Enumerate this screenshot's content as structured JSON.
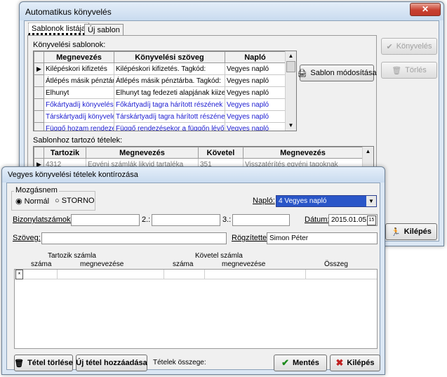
{
  "main_window": {
    "title": "Automatikus könyvelés",
    "close": "✕",
    "tabs": [
      "Sablonok listája",
      "Új sablon"
    ],
    "templates_label": "Könyvelési sablonok:",
    "templates_columns": [
      "Megnevezés",
      "Könyvelési szöveg",
      "Napló"
    ],
    "templates_rows": [
      {
        "name": "Kilépéskori kifizetés",
        "text": "Kilépéskori kifizetés. Tagkód:",
        "journal": "Vegyes napló",
        "color": "#000000"
      },
      {
        "name": "Átlépés másik pénztárba",
        "text": "Átlépés másik pénztárba. Tagkód:",
        "journal": "Vegyes napló",
        "color": "#000000"
      },
      {
        "name": "Elhunyt",
        "text": "Elhunyt tag fedezeti alapjának kiizetése",
        "journal": "Vegyes napló",
        "color": "#000000"
      },
      {
        "name": "Főkártyadíj könyvelése",
        "text": "Főkártyadíj tagra hárított részének könyvelése",
        "journal": "Vegyes napló",
        "color": "#1a1ad0"
      },
      {
        "name": "Társkártyadíj könyvelése",
        "text": "Társkártyadíj tagra hárított részének könyvelése",
        "journal": "Vegyes napló",
        "color": "#1a1ad0"
      },
      {
        "name": "Függő hozam rendezése",
        "text": "Függő rendezésekor a függőn lévő hozam",
        "journal": "Vegyes napló",
        "color": "#1a1ad0"
      }
    ],
    "sablon_modositasa": "Sablon módosítása",
    "konyveles": "Könyvelés",
    "torles": "Törlés",
    "items_label": "Sablonhoz tartozó tételek:",
    "items_columns": [
      "Tartozik",
      "Megnevezés",
      "Követel",
      "Megnevezés"
    ],
    "items_rows": [
      {
        "debit": "4312",
        "debit_name": "Egyéni számlák likvid tartaléka",
        "credit": "351",
        "credit_name": "Visszatérítés egyéni tagoknak"
      }
    ],
    "kilepes": "Kilépés"
  },
  "dialog": {
    "title": "Vegyes könyvelési tételek kontírozása",
    "mozgasnem": "Mozgásnem",
    "radio_normal": "Normál",
    "radio_storno": "STORNO",
    "naplo_label": "Napló:",
    "naplo_value": "4 Vegyes napló",
    "bizonylatszamok_label": "Bizonylatszámok: 1.:",
    "biz2_label": "2.:",
    "biz3_label": "3.:",
    "datum_label": "Dátum:",
    "datum_value": "2015.01.05",
    "szoveg_label": "Szöveg:",
    "rogzitette_label": "Rögzítette:",
    "rogzitette_value": "Simon Péter",
    "tartozik_szamla": "Tartozik számla",
    "kovetel_szamla": "Követel számla",
    "col_szama1": "száma",
    "col_megnevezese1": "megnevezése",
    "col_szama2": "száma",
    "col_megnevezese2": "megnevezése",
    "col_osszeg": "Összeg",
    "new_row_marker": "*",
    "tetel_torlese": "Tétel törlése",
    "uj_tetel": "Új tétel hozzáadása",
    "tetelek_osszege": "Tételek összege:",
    "mentes": "Mentés",
    "kilepes": "Kilépés"
  }
}
